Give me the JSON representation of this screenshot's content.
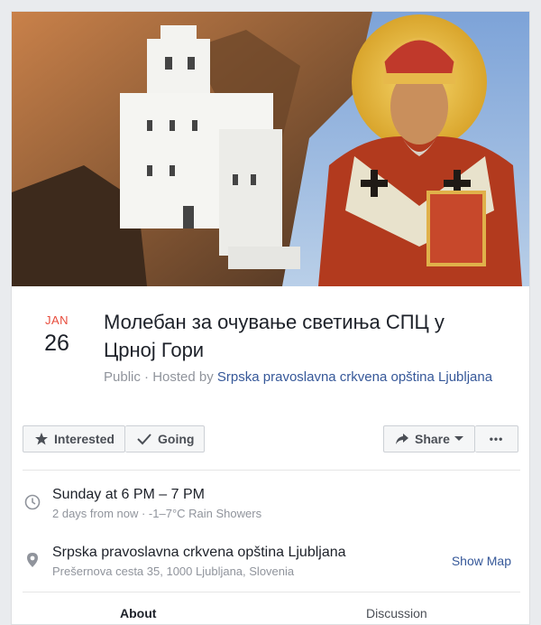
{
  "event": {
    "month": "JAN",
    "day": "26",
    "title": "Молебан за очување светиња СПЦ у Црној Гори",
    "privacy": "Public",
    "hosted_by_prefix": " · Hosted by ",
    "host": "Srpska pravoslavna crkvena opština Ljubljana"
  },
  "actions": {
    "interested": "Interested",
    "going": "Going",
    "share": "Share",
    "more": "•••"
  },
  "details": {
    "time": "Sunday at 6 PM – 7 PM",
    "time_sub": "2 days from now · -1–7°C Rain Showers",
    "place": "Srpska pravoslavna crkvena opština Ljubljana",
    "address": "Prešernova cesta 35, 1000 Ljubljana, Slovenia",
    "show_map": "Show Map"
  },
  "tabs": [
    "About",
    "Discussion"
  ],
  "icons": {
    "interested": "star-icon",
    "going": "checkmark-icon",
    "share": "share-arrow-icon",
    "dropdown": "caret-down-icon",
    "time": "clock-icon",
    "place": "map-pin-icon"
  },
  "colors": {
    "month": "#e74c3c",
    "link": "#365899",
    "muted": "#90949c",
    "text": "#1d2129"
  }
}
